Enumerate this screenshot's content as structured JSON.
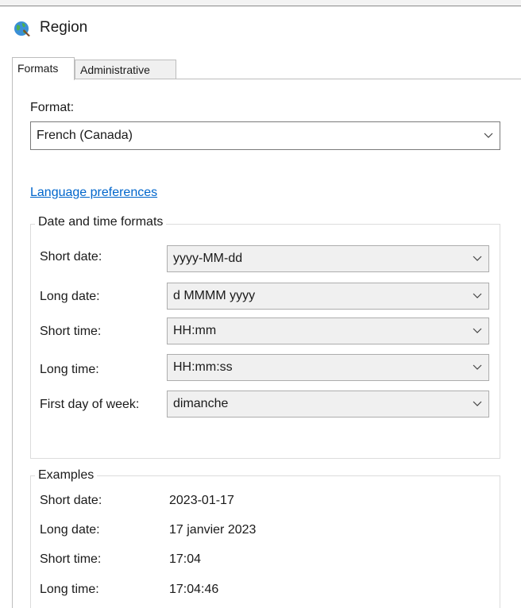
{
  "window": {
    "title": "Region",
    "app_icon": "globe-icon"
  },
  "tabs": [
    {
      "label": "Formats",
      "active": true
    },
    {
      "label": "Administrative",
      "active": false
    }
  ],
  "format": {
    "label": "Format:",
    "value": "French (Canada)"
  },
  "language_preferences_link": "Language preferences",
  "date_time_formats": {
    "legend": "Date and time formats",
    "rows": [
      {
        "label": "Short date:",
        "value": "yyyy-MM-dd"
      },
      {
        "label": "Long date:",
        "value": "d MMMM yyyy"
      },
      {
        "label": "Short time:",
        "value": "HH:mm"
      },
      {
        "label": "Long time:",
        "value": "HH:mm:ss"
      },
      {
        "label": "First day of week:",
        "value": "dimanche"
      }
    ]
  },
  "examples": {
    "legend": "Examples",
    "rows": [
      {
        "label": "Short date:",
        "value": "2023-01-17"
      },
      {
        "label": "Long date:",
        "value": "17 janvier 2023"
      },
      {
        "label": "Short time:",
        "value": "17:04"
      },
      {
        "label": "Long time:",
        "value": "17:04:46"
      }
    ]
  },
  "colors": {
    "link": "#0066cc",
    "combo_background": "#f0f0f0"
  }
}
